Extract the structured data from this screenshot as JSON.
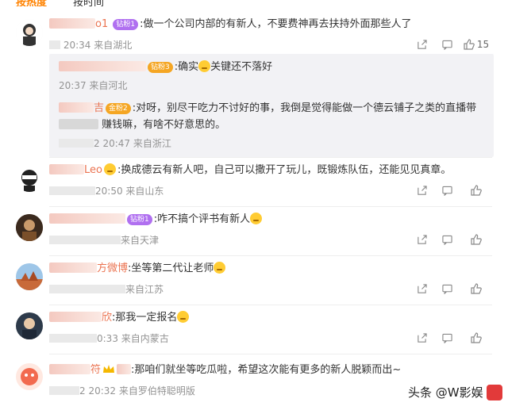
{
  "top": {
    "tab_hot": "按热度",
    "tab_time": "按时间"
  },
  "comments": [
    {
      "user_suffix": "o1",
      "badge": "钻粉1",
      "text": ":做一个公司内部的有新人，不要费神再去扶持外面那些人了",
      "time": "20:34",
      "location": "来自湖北",
      "likes": "15",
      "replies": [
        {
          "badge": "钻粉3",
          "text": ":确实",
          "text2": "关键还不落好",
          "time": "20:37",
          "location": "来自河北"
        },
        {
          "user_suffix": "吉",
          "badge": "金粉2",
          "text": ":对呀，别尽干吃力不讨好的事，我倒是觉得能做一个德云铺子之类的直播带",
          "text_cont": "赚钱嘛，有啥不好意思的。",
          "time": "2 20:47",
          "location": "来自浙江"
        }
      ]
    },
    {
      "user_suffix": "Leo",
      "text": ":换成德云有新人吧，自己可以撒开了玩儿，既锻炼队伍，还能见见真章。",
      "time": "20:50",
      "location": "来自山东"
    },
    {
      "badge": "钻粉1",
      "text": ":咋不搞个评书有新人",
      "location": "来自天津"
    },
    {
      "user_suffix": "方微博",
      "text": ":坐等第二代让老师",
      "location": "来自江苏"
    },
    {
      "user_suffix": "欣",
      "text": ":那我一定报名",
      "time": "0:33",
      "location": "来自内蒙古"
    },
    {
      "user_suffix": "符",
      "text": ":那咱们就坐等吃瓜啦，希望这次能有更多的新人脱颖而出~",
      "time": "2 20:32",
      "location": "来自罗伯特聪明版"
    }
  ],
  "watermark": "头条 @W影娱",
  "colors": {
    "username": "#eb7350",
    "meta": "#939393",
    "reply_bg": "#f2f2f5"
  }
}
